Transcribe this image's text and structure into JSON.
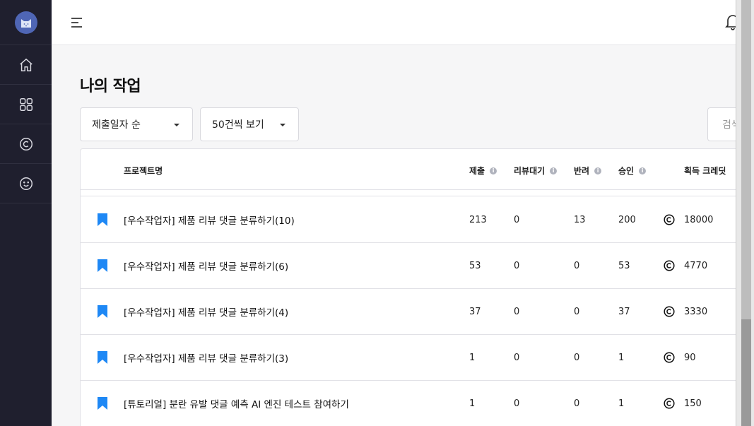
{
  "page": {
    "title": "나의 작업"
  },
  "filters": {
    "sort_label": "제출일자 순",
    "page_size_label": "50건씩 보기",
    "search_placeholder": "검색"
  },
  "sidebar": {
    "items": [
      {
        "icon": "home-icon"
      },
      {
        "icon": "grid-icon"
      },
      {
        "icon": "credit-icon"
      },
      {
        "icon": "smile-icon"
      }
    ]
  },
  "table": {
    "headers": {
      "project": "프로젝트명",
      "submitted": "제출",
      "pending": "리뷰대기",
      "rejected": "반려",
      "approved": "승인",
      "credits": "획득 크레딧"
    },
    "rows": [
      {
        "name": "[우수작업자] 제품 리뷰 댓글 분류하기(10)",
        "submitted": "213",
        "pending": "0",
        "rejected": "13",
        "approved": "200",
        "credits": "18000"
      },
      {
        "name": "[우수작업자] 제품 리뷰 댓글 분류하기(6)",
        "submitted": "53",
        "pending": "0",
        "rejected": "0",
        "approved": "53",
        "credits": "4770"
      },
      {
        "name": "[우수작업자] 제품 리뷰 댓글 분류하기(4)",
        "submitted": "37",
        "pending": "0",
        "rejected": "0",
        "approved": "37",
        "credits": "3330"
      },
      {
        "name": "[우수작업자] 제품 리뷰 댓글 분류하기(3)",
        "submitted": "1",
        "pending": "0",
        "rejected": "0",
        "approved": "1",
        "credits": "90"
      },
      {
        "name": "[튜토리얼] 분란 유발 댓글 예측 AI 엔진 테스트 참여하기",
        "submitted": "1",
        "pending": "0",
        "rejected": "0",
        "approved": "1",
        "credits": "150"
      }
    ]
  },
  "colors": {
    "sidebar_bg": "#1f1f2e",
    "bookmark": "#1e88f5",
    "accent_avatar": "#4f66b5"
  }
}
